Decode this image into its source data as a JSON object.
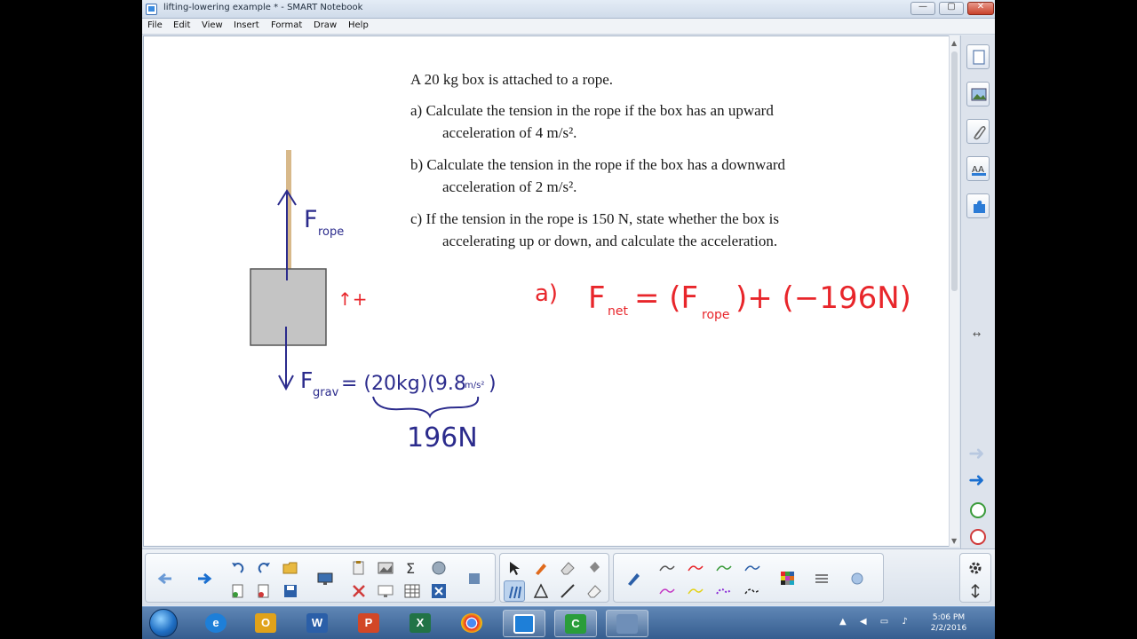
{
  "window": {
    "title": "lifting-lowering example * - SMART Notebook",
    "min_glyph": "—",
    "max_glyph": "▢",
    "close_glyph": "✕"
  },
  "menu": [
    "File",
    "Edit",
    "View",
    "Insert",
    "Format",
    "Draw",
    "Help"
  ],
  "problem": {
    "intro": "A 20 kg box is attached to a rope.",
    "a_line1": "a) Calculate the tension in the rope if the box has an upward",
    "a_line2": "acceleration of 4 m/s².",
    "b_line1": "b) Calculate the tension in the rope if the box has a downward",
    "b_line2": "acceleration of 2 m/s².",
    "c_line1": "c) If the tension in the rope is 150 N, state whether the box is",
    "c_line2": "accelerating up or down, and calculate the acceleration."
  },
  "handwriting": {
    "f_rope_main": "F",
    "f_rope_sub": "rope",
    "plus_dir": "↑+",
    "f_grav_main": "F",
    "f_grav_sub": "grav",
    "f_grav_eq": "= (20kg)(9.8",
    "f_grav_unit": "m/s²",
    "f_grav_close": ")",
    "result": "196N",
    "eq_label": "a)",
    "eq_fnet": "F",
    "eq_fnet_sub": "net",
    "eq_mid": "= (F",
    "eq_rope_sub": "rope",
    "eq_rest": ")+ (−196N)"
  },
  "colors": {
    "ink_blue": "#2b2b8c",
    "ink_red": "#e8262b",
    "box_gray": "#c4c4c4",
    "rope": "#d8b98a"
  },
  "taskbar": {
    "apps": [
      "internet-explorer",
      "outlook",
      "word",
      "powerpoint",
      "excel",
      "chrome",
      "smart-notebook",
      "camtasia",
      "recorder"
    ],
    "time": "5:06 PM",
    "date": "2/2/2016"
  },
  "sidebar_tabs": [
    "page-sorter",
    "gallery",
    "attachments",
    "properties",
    "add-ons"
  ]
}
